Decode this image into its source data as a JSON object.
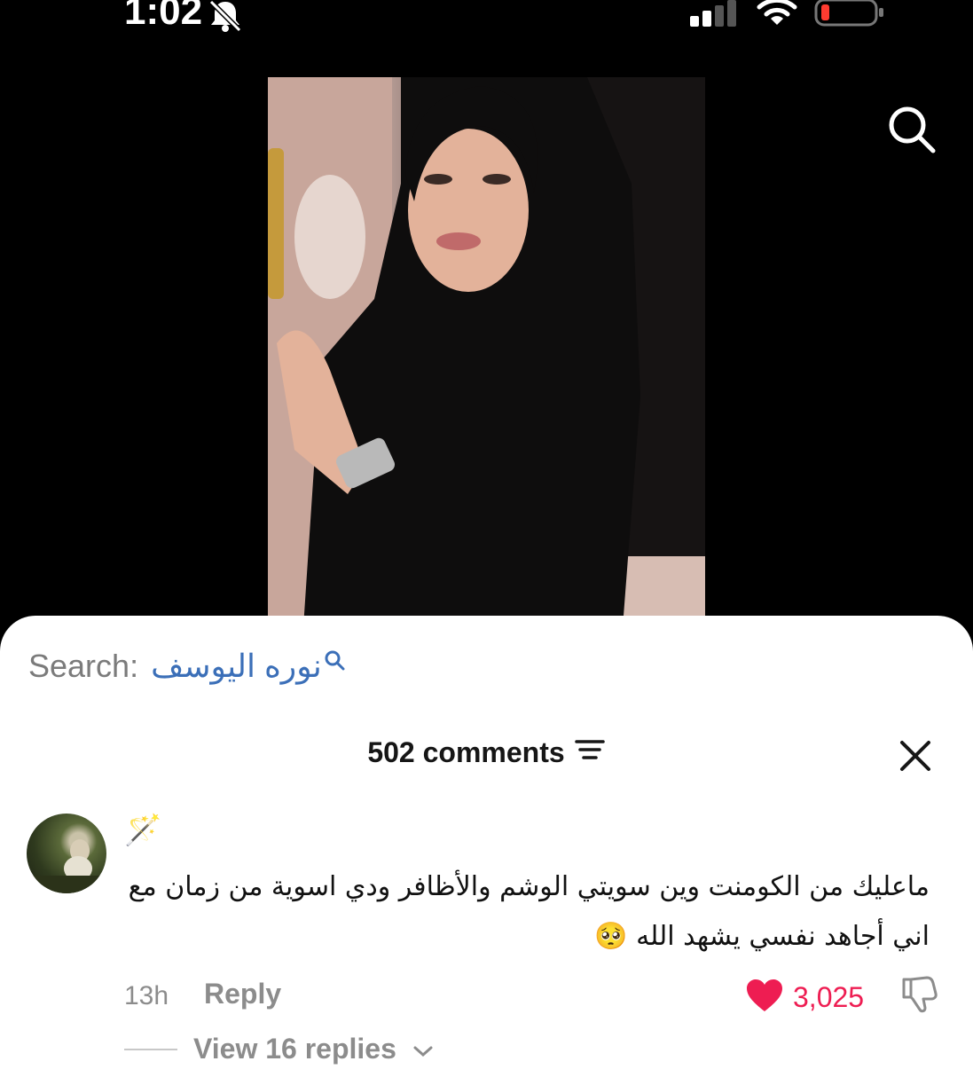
{
  "status_bar": {
    "time": "1:02",
    "icons": [
      "bell-slash-icon",
      "cellular-signal-icon",
      "wifi-icon",
      "battery-low-icon"
    ]
  },
  "video": {
    "search_icon": "search-icon"
  },
  "search_bar": {
    "label": "Search:",
    "query": "نوره اليوسف",
    "icon": "search-icon"
  },
  "comments": {
    "header": "502 comments",
    "sort_icon": "filter-lines-icon",
    "close_icon": "close-icon",
    "items": [
      {
        "username": "🪄",
        "text_line1": "ماعليك من الكومنت وين سويتي الوشم والأظافر ودي اسوية من زمان مع",
        "text_line2": "اني أجاهد نفسي يشهد الله 🥺",
        "time": "13h",
        "reply_label": "Reply",
        "likes": "3,025",
        "view_replies": "View 16 replies"
      }
    ]
  },
  "colors": {
    "like": "#ee1d52",
    "link": "#3b6fb8",
    "muted": "#8c8c8c"
  }
}
